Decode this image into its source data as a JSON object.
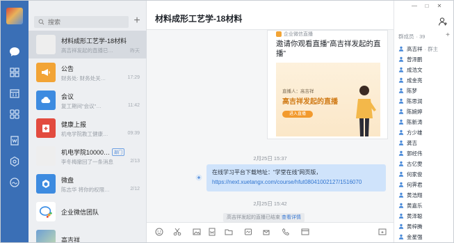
{
  "nav": {
    "icons": [
      "message-icon",
      "contacts-icon",
      "calendar-icon",
      "apps-icon",
      "docs-icon",
      "drive-icon",
      "mail-icon"
    ]
  },
  "search": {
    "placeholder": "搜索"
  },
  "conversations": [
    {
      "title": "材料成形工艺学-18材料",
      "sub": "高吉祥发起的直播已…",
      "time": "昨天",
      "icon": "group-avatar"
    },
    {
      "title": "公告",
      "sub": "财务处: 财务处关…",
      "time": "17:29",
      "icon": "megaphone-icon"
    },
    {
      "title": "会议",
      "sub": "复工期间\"会议\"…",
      "time": "11:42",
      "icon": "cloud-icon"
    },
    {
      "title": "健康上报",
      "sub": "机电学院教工健康…",
      "time": "09:39",
      "icon": "health-icon"
    },
    {
      "title": "机电学院10000…",
      "tag": "部门",
      "sub": "李冬梅撤回了一条消息",
      "time": "2/13",
      "icon": "group-avatar"
    },
    {
      "title": "微盘",
      "sub": "陈志华 将你的权限…",
      "time": "2/12",
      "icon": "drive-icon"
    },
    {
      "title": "企业微信团队",
      "sub": "",
      "time": "",
      "icon": "wework-icon"
    },
    {
      "title": "高吉祥",
      "sub": "",
      "time": "",
      "icon": "person-avatar"
    }
  ],
  "chat": {
    "title": "材料成形工艺学-18材料",
    "card": {
      "source": "企业微信直播",
      "title": "邀请你观看直播“高吉祥发起的直播”",
      "host": "直播人：高吉祥",
      "live_title": "高吉祥发起的直播",
      "button": "进入直播"
    },
    "timestamp1": "2月25日 15:37",
    "bubble": {
      "text": "在线学习平台下载地址：“学堂在线”网页版，",
      "link": "https://next.xuetangx.com/course/hfut08041002127/1516070"
    },
    "timestamp2": "2月25日 15:42",
    "system": {
      "text": "高吉祥发起的直播已结束",
      "link": "查看详情"
    }
  },
  "toolbar": {
    "icons": [
      "emoji-icon",
      "scissors-icon",
      "image-icon",
      "file-icon",
      "folder-icon",
      "screenshot-icon",
      "phone-icon",
      "schedule-icon",
      "expand-icon"
    ]
  },
  "window": {
    "minimize": "—",
    "maximize": "□",
    "close": "✕"
  },
  "members": {
    "title": "群成员",
    "count": "· 39",
    "list": [
      {
        "name": "高吉祥",
        "role": "· 群主"
      },
      {
        "name": "曾泽鹏"
      },
      {
        "name": "成浩文"
      },
      {
        "name": "成金亮"
      },
      {
        "name": "陈梦"
      },
      {
        "name": "陈思润"
      },
      {
        "name": "陈婉婷"
      },
      {
        "name": "陈新涛"
      },
      {
        "name": "方少雄"
      },
      {
        "name": "龚吉"
      },
      {
        "name": "郭经伟"
      },
      {
        "name": "古亿雯"
      },
      {
        "name": "何家俊"
      },
      {
        "name": "何霁君"
      },
      {
        "name": "黄浩翔"
      },
      {
        "name": "黄嘉乐"
      },
      {
        "name": "黄泽聪"
      },
      {
        "name": "黄梓腾"
      },
      {
        "name": "金星强"
      }
    ]
  },
  "colors": {
    "nav_bg": "#3a6fb6",
    "accent": "#2f74cf",
    "bubble_bg": "#cfe3fb",
    "live_orange": "#f29a2e"
  }
}
